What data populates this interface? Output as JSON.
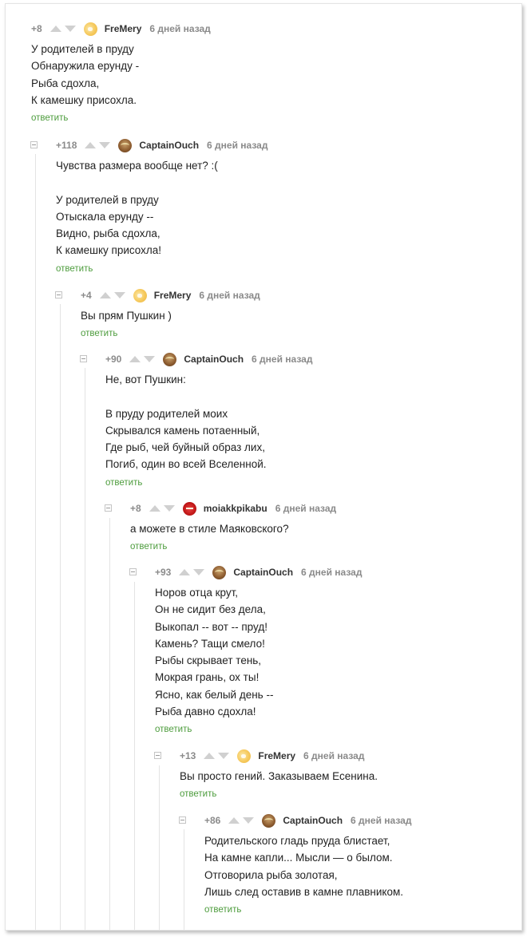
{
  "comments": [
    {
      "rating": "+8",
      "user": "FreMery",
      "time": "6 дней назад",
      "avatar": "cat",
      "lines": [
        "У родителей в пруду",
        "Обнаружила ерунду -",
        "Рыба сдохла,",
        "К камешку присохла."
      ],
      "reply": "ответить"
    },
    {
      "rating": "+118",
      "user": "CaptainOuch",
      "time": "6 дней назад",
      "avatar": "owl",
      "lines": [
        "Чувства размера вообще нет? :(",
        "",
        "У родителей в пруду",
        "Отыскала ерунду --",
        "Видно, рыба сдохла,",
        "К камешку присохла!"
      ],
      "reply": "ответить"
    },
    {
      "rating": "+4",
      "user": "FreMery",
      "time": "6 дней назад",
      "avatar": "cat",
      "lines": [
        "Вы прям Пушкин )"
      ],
      "reply": "ответить"
    },
    {
      "rating": "+90",
      "user": "CaptainOuch",
      "time": "6 дней назад",
      "avatar": "owl",
      "lines": [
        "Не, вот Пушкин:",
        "",
        "В пруду родителей моих",
        "Скрывался камень потаенный,",
        "Где рыб, чей буйный образ лих,",
        "Погиб, один во всей Вселенной."
      ],
      "reply": "ответить"
    },
    {
      "rating": "+8",
      "user": "moiakkpikabu",
      "time": "6 дней назад",
      "avatar": "red",
      "lines": [
        "а можете в стиле Маяковского?"
      ],
      "reply": "ответить"
    },
    {
      "rating": "+93",
      "user": "CaptainOuch",
      "time": "6 дней назад",
      "avatar": "owl",
      "lines": [
        "Норов отца крут,",
        "Он не сидит без дела,",
        "Выкопал -- вот -- пруд!",
        "Камень? Тащи смело!",
        "Рыбы скрывает тень,",
        "Мокрая грань, ох ты!",
        "Ясно, как белый день --",
        "Рыба давно сдохла!"
      ],
      "reply": "ответить"
    },
    {
      "rating": "+13",
      "user": "FreMery",
      "time": "6 дней назад",
      "avatar": "cat",
      "lines": [
        "Вы просто гений. Заказываем Есенина."
      ],
      "reply": "ответить"
    },
    {
      "rating": "+86",
      "user": "CaptainOuch",
      "time": "6 дней назад",
      "avatar": "owl",
      "lines": [
        "Родительского гладь пруда блистает,",
        "На камне капли... Мысли — о былом.",
        "Отговорила рыба золотая,",
        "Лишь след оставив в камне плавником."
      ],
      "reply": "ответить"
    }
  ]
}
